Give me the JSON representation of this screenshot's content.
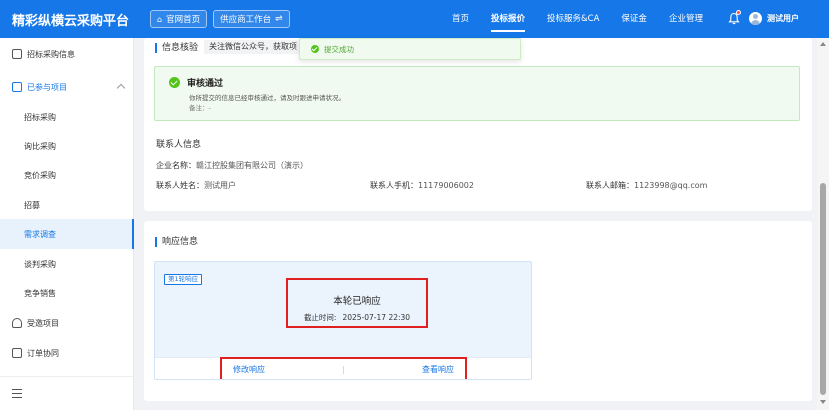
{
  "header": {
    "brand": "精彩纵横云采购平台",
    "home_button": "官网首页",
    "workbench_button": "供应商工作台",
    "nav": [
      "首页",
      "投标报价",
      "投标服务&CA",
      "保证金",
      "企业管理"
    ],
    "active_nav_index": 1,
    "user_name": "测试用户",
    "has_notification": true
  },
  "sidebar": {
    "top_item": "招标采购信息",
    "group_label": "已参与项目",
    "sub_items": [
      "招标采购",
      "询比采购",
      "竞价采购",
      "招募",
      "需求调查",
      "谈判采购",
      "竞争销售"
    ],
    "active_sub_index": 4,
    "other_items": [
      "受邀项目",
      "订单协同"
    ]
  },
  "info_section": {
    "title": "信息核验",
    "wechat_tip": "关注微信公众号，获取项",
    "approval": {
      "title": "审核通过",
      "desc": "你所提交的信息已经审核通过，请及时跟进申请状况。",
      "note": "备注：-"
    },
    "contact": {
      "heading": "联系人信息",
      "company_label": "企业名称：",
      "company_value": "赣江控股集团有限公司（演示）",
      "name_label": "联系人姓名：",
      "name_value": "测试用户",
      "phone_label": "联系人手机：",
      "phone_value": "11179006002",
      "email_label": "联系人邮箱：",
      "email_value": "1123998@qq.com"
    }
  },
  "response_section": {
    "title": "响应信息",
    "round_tag": "第1轮响应",
    "status": "本轮已响应",
    "deadline_label": "截止时间:",
    "deadline_value": "2025-07-17 22:30",
    "modify_label": "修改响应",
    "view_label": "查看响应"
  },
  "toast": {
    "text": "提交成功"
  },
  "colors": {
    "primary": "#1677e8",
    "success": "#52c41a",
    "highlight": "#e02020"
  }
}
